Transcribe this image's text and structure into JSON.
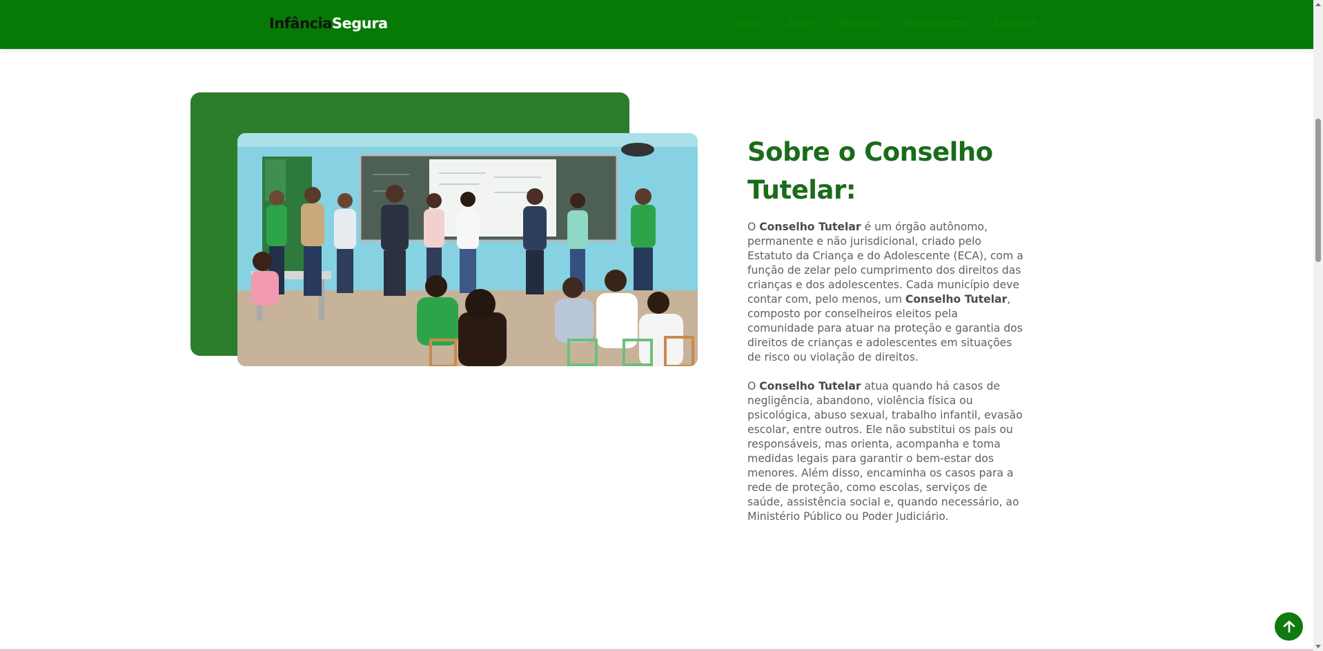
{
  "brand": {
    "part1": "Infância",
    "part2": "Segura"
  },
  "nav": {
    "items": [
      "Início",
      "Sobre",
      "Atuação",
      "Atendimento",
      "Contatos"
    ]
  },
  "about": {
    "title": "Sobre o Conselho Tutelar:",
    "p1": [
      {
        "t": "O ",
        "b": false
      },
      {
        "t": "Conselho Tutelar",
        "b": true
      },
      {
        "t": " é um órgão autônomo, permanente e não jurisdicional, criado pelo Estatuto da Criança e do Adolescente (ECA), com a função de zelar pelo cumprimento dos direitos das crianças e dos adolescentes. Cada município deve contar com, pelo menos, um ",
        "b": false
      },
      {
        "t": "Conselho Tutelar",
        "b": true
      },
      {
        "t": ", composto por conselheiros eleitos pela comunidade para atuar na proteção e garantia dos direitos de crianças e adolescentes em situações de risco ou violação de direitos.",
        "b": false
      }
    ],
    "p2": [
      {
        "t": "O ",
        "b": false
      },
      {
        "t": "Conselho Tutelar",
        "b": true
      },
      {
        "t": " atua quando há casos de negligência, abandono, violência física ou psicológica, abuso sexual, trabalho infantil, evasão escolar, entre outros. Ele não substitui os pais ou responsáveis, mas orienta, acompanha e toma medidas legais para garantir o bem-estar dos menores. Além disso, encaminha os casos para a rede de proteção, como escolas, serviços de saúde, assistência social e, quando necessário, ao Ministério Público ou Poder Judiciário.",
        "b": false
      }
    ]
  },
  "icons": {
    "scroll_top": "arrow-up-icon"
  },
  "colors": {
    "primary": "#057a05",
    "heading": "#1a6b1a",
    "block": "#2b7d2b"
  }
}
